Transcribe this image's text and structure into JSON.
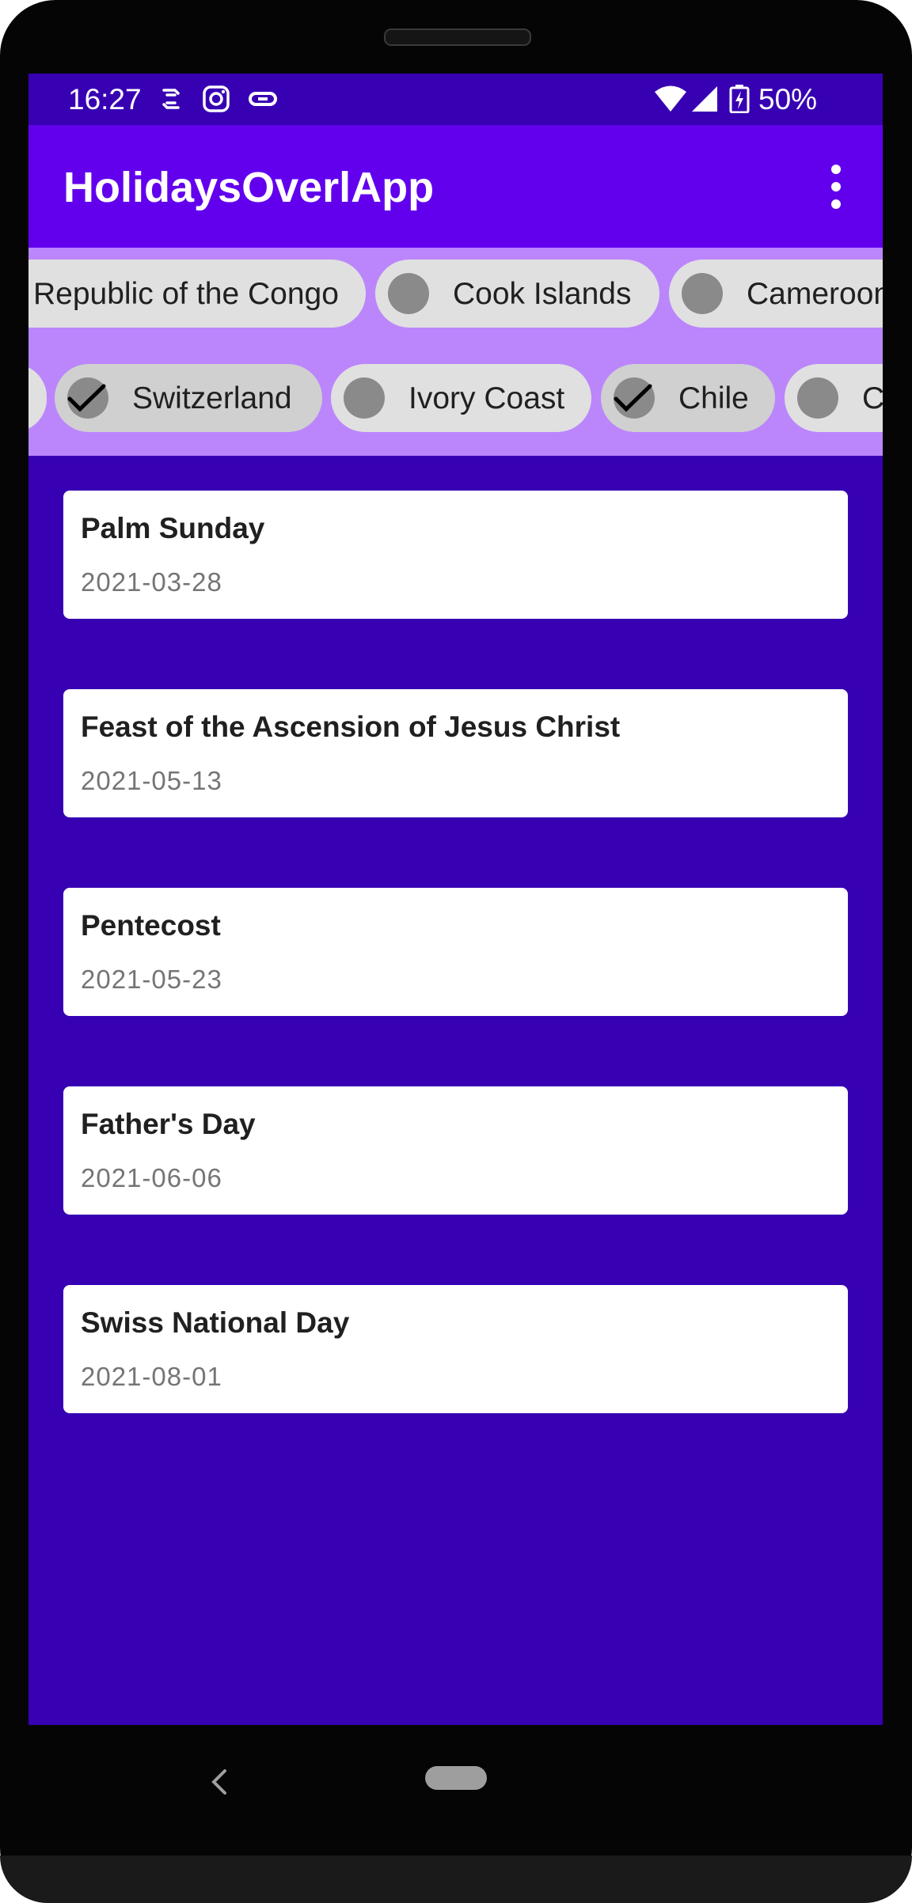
{
  "status_bar": {
    "time": "16:27",
    "left_icons": [
      "sync-icon",
      "instagram-icon",
      "link-icon"
    ],
    "battery_percent": "50%",
    "right_icons": [
      "wifi-icon",
      "signal-icon",
      "battery-charging-icon"
    ]
  },
  "app_bar": {
    "title": "HolidaysOverlApp",
    "overflow_icon": "more-vert-icon"
  },
  "chips": {
    "row1": [
      {
        "label": "Republic of the Congo",
        "checked": false
      },
      {
        "label": "Cook Islands",
        "checked": false
      },
      {
        "label": "Cameroon",
        "checked": false
      }
    ],
    "row2": [
      {
        "label": "",
        "checked": false
      },
      {
        "label": "Switzerland",
        "checked": true
      },
      {
        "label": "Ivory Coast",
        "checked": false
      },
      {
        "label": "Chile",
        "checked": true
      },
      {
        "label": "C",
        "checked": false
      }
    ]
  },
  "holidays": [
    {
      "name": "Palm Sunday",
      "date": "2021-03-28"
    },
    {
      "name": "Feast of the Ascension of Jesus Christ",
      "date": "2021-05-13"
    },
    {
      "name": "Pentecost",
      "date": "2021-05-23"
    },
    {
      "name": "Father's Day",
      "date": "2021-06-06"
    },
    {
      "name": "Swiss National Day",
      "date": "2021-08-01"
    }
  ],
  "nav": {
    "back_icon": "back-icon",
    "home_icon": "home-pill-icon"
  },
  "colors": {
    "status_bar": "#3700b3",
    "app_bar": "#6200ee",
    "chip_area": "#bb86fc",
    "background": "#3700b3",
    "card": "#ffffff"
  }
}
